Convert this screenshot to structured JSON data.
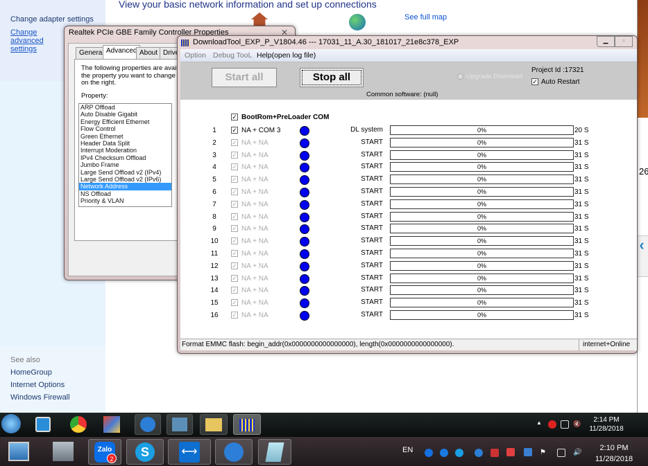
{
  "control_panel": {
    "title": "View your basic network information and set up connections",
    "see_full_map": "See full map",
    "left_links": [
      "Change adapter settings",
      "Change advanced settings"
    ],
    "see_also_label": "See also",
    "see_also": [
      "HomeGroup",
      "Internet Options",
      "Windows Firewall"
    ],
    "partial_text": "26"
  },
  "realtek": {
    "title": "Realtek PCIe GBE Family Controller Properties",
    "tabs": [
      "General",
      "Advanced",
      "About",
      "Driver"
    ],
    "active_tab": "Advanced",
    "description": "The following properties are available for this network adapter. Click the property you want to change on the left, and then select its value on the right.",
    "description_lines": [
      "The following properties are available",
      "the property you want to change on t",
      "on the right."
    ],
    "property_label": "Property:",
    "properties": [
      "ARP Offload",
      "Auto Disable Gigabit",
      "Energy Efficient Ethernet",
      "Flow Control",
      "Green Ethernet",
      "Header Data Split",
      "Interrupt Moderation",
      "IPv4 Checksum Offload",
      "Jumbo Frame",
      "Large Send Offload v2 (IPv4)",
      "Large Send Offload v2 (IPv6)",
      "Network Address",
      "NS Offload",
      "Priority & VLAN"
    ],
    "selected_property": "Network Address"
  },
  "download_tool": {
    "title": "DownloadTool_EXP_P_V1804.46 --- 17031_11_A.30_181017_21e8c378_EXP",
    "menu": [
      "Option",
      "Debug TooL",
      "Help(open log file)"
    ],
    "start_all": "Start all",
    "stop_all": "Stop all",
    "upgrade_download": "Upgrade Download",
    "project_id": "Project Id :17321",
    "auto_restart": "Auto Restart",
    "auto_restart_checked": true,
    "common_software": "Common software: (null)",
    "header_checkbox": "BootRom+PreLoader COM",
    "ports": [
      {
        "num": "1",
        "label": "NA + COM  3",
        "enabled": true,
        "status": "DL system",
        "progress": "0%",
        "time": "20 S"
      },
      {
        "num": "2",
        "label": "NA + NA",
        "enabled": false,
        "status": "START",
        "progress": "0%",
        "time": "31 S"
      },
      {
        "num": "3",
        "label": "NA + NA",
        "enabled": false,
        "status": "START",
        "progress": "0%",
        "time": "31 S"
      },
      {
        "num": "4",
        "label": "NA + NA",
        "enabled": false,
        "status": "START",
        "progress": "0%",
        "time": "31 S"
      },
      {
        "num": "5",
        "label": "NA + NA",
        "enabled": false,
        "status": "START",
        "progress": "0%",
        "time": "31 S"
      },
      {
        "num": "6",
        "label": "NA + NA",
        "enabled": false,
        "status": "START",
        "progress": "0%",
        "time": "31 S"
      },
      {
        "num": "7",
        "label": "NA + NA",
        "enabled": false,
        "status": "START",
        "progress": "0%",
        "time": "31 S"
      },
      {
        "num": "8",
        "label": "NA + NA",
        "enabled": false,
        "status": "START",
        "progress": "0%",
        "time": "31 S"
      },
      {
        "num": "9",
        "label": "NA + NA",
        "enabled": false,
        "status": "START",
        "progress": "0%",
        "time": "31 S"
      },
      {
        "num": "10",
        "label": "NA + NA",
        "enabled": false,
        "status": "START",
        "progress": "0%",
        "time": "31 S"
      },
      {
        "num": "11",
        "label": "NA + NA",
        "enabled": false,
        "status": "START",
        "progress": "0%",
        "time": "31 S"
      },
      {
        "num": "12",
        "label": "NA + NA",
        "enabled": false,
        "status": "START",
        "progress": "0%",
        "time": "31 S"
      },
      {
        "num": "13",
        "label": "NA + NA",
        "enabled": false,
        "status": "START",
        "progress": "0%",
        "time": "31 S"
      },
      {
        "num": "14",
        "label": "NA + NA",
        "enabled": false,
        "status": "START",
        "progress": "0%",
        "time": "31 S"
      },
      {
        "num": "15",
        "label": "NA + NA",
        "enabled": false,
        "status": "START",
        "progress": "0%",
        "time": "31 S"
      },
      {
        "num": "16",
        "label": "NA + NA",
        "enabled": false,
        "status": "START",
        "progress": "0%",
        "time": "31 S"
      }
    ],
    "status_left": "Format EMMC flash:  begin_addr(0x0000000000000000), length(0x0000000000000000).",
    "status_right": "internet+Online",
    "dot_color": "#0000f0"
  },
  "taskbar_remote": {
    "apps": [
      "windows-start",
      "media-player",
      "chrome",
      "app",
      "remote-desktop",
      "control-panel",
      "file-explorer",
      "download-tool"
    ],
    "time": "2:14 PM",
    "date": "11/28/2018"
  },
  "taskbar_local": {
    "apps": [
      "computer",
      "network",
      "Zalo",
      "skype",
      "teamviewer",
      "remote-desktop",
      "notepad"
    ],
    "zalo_badge": "2",
    "zalo_label": "Zalo",
    "language": "EN",
    "time": "2:10 PM",
    "date": "11/28/2018"
  }
}
